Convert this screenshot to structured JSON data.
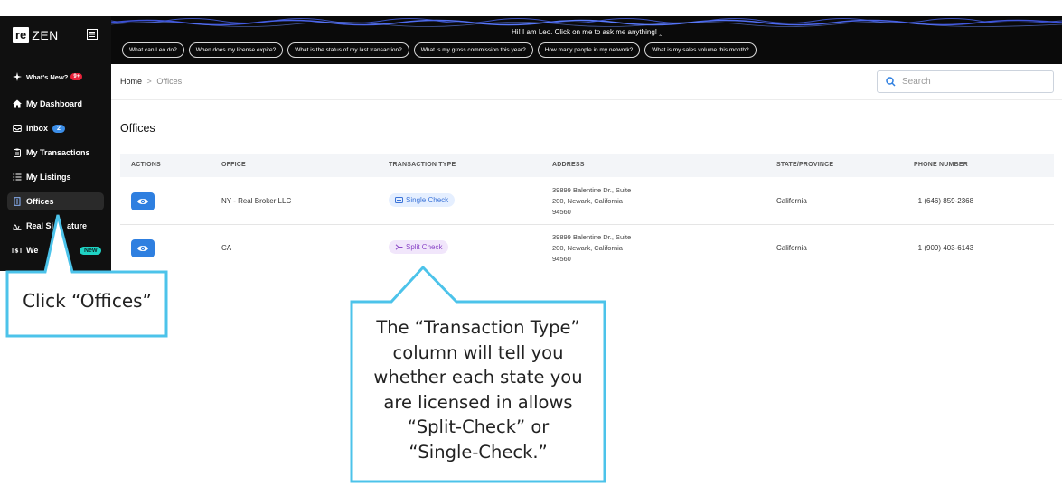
{
  "brand": {
    "logo_left": "re",
    "logo_right": "ZEN"
  },
  "sidebar": {
    "whats_new": {
      "label": "What's New?",
      "badge": "9+"
    },
    "items": [
      {
        "label": "My Dashboard",
        "icon": "home-icon"
      },
      {
        "label": "Inbox",
        "icon": "inbox-icon",
        "badge": "2"
      },
      {
        "label": "My Transactions",
        "icon": "clipboard-icon"
      },
      {
        "label": "My Listings",
        "icon": "list-icon"
      },
      {
        "label": "Offices",
        "icon": "office-icon"
      },
      {
        "label": "Real Si",
        "icon": "signature-icon"
      },
      {
        "label": "We",
        "icon": "wealth-icon",
        "badge": "New"
      }
    ],
    "item_tail": {
      "signature": "ature"
    }
  },
  "banner": {
    "text": "Hi! I am Leo. Click on me to ask me anything!",
    "chips": [
      "What can Leo do?",
      "When does my license expire?",
      "What is the status of my last transaction?",
      "What is my gross commission this year?",
      "How many people in my network?",
      "What is my sales volume this month?"
    ]
  },
  "breadcrumb": {
    "home": "Home",
    "separator": ">",
    "current": "Offices"
  },
  "search": {
    "placeholder": "Search"
  },
  "page": {
    "title": "Offices"
  },
  "table": {
    "columns": [
      "ACTIONS",
      "OFFICE",
      "TRANSACTION TYPE",
      "ADDRESS",
      "STATE/PROVINCE",
      "PHONE NUMBER"
    ],
    "rows": [
      {
        "office": "NY - Real Broker LLC",
        "transaction_type": "Single Check",
        "address_lines": [
          "39899 Balentine Dr., Suite",
          "200, Newark, California",
          "94560"
        ],
        "state": "California",
        "phone": "+1 (646) 859-2368"
      },
      {
        "office": "CA",
        "transaction_type": "Split Check",
        "address_lines": [
          "39899 Balentine Dr., Suite",
          "200, Newark, California",
          "94560"
        ],
        "state": "California",
        "phone": "+1 (909) 403-6143"
      }
    ]
  },
  "callouts": {
    "offices": "Click “Offices”",
    "transaction_type": [
      "The “Transaction Type”",
      "column will tell you",
      "whether each state you",
      "are licensed in allows",
      "“Split-Check” or",
      "“Single-Check.”"
    ]
  },
  "colors": {
    "callout_border": "#4cc3ea",
    "primary_blue": "#2e7fe0",
    "sidebar_bg": "#101010",
    "new_badge": "#1fd3c4",
    "notification_red": "#e8223a"
  }
}
